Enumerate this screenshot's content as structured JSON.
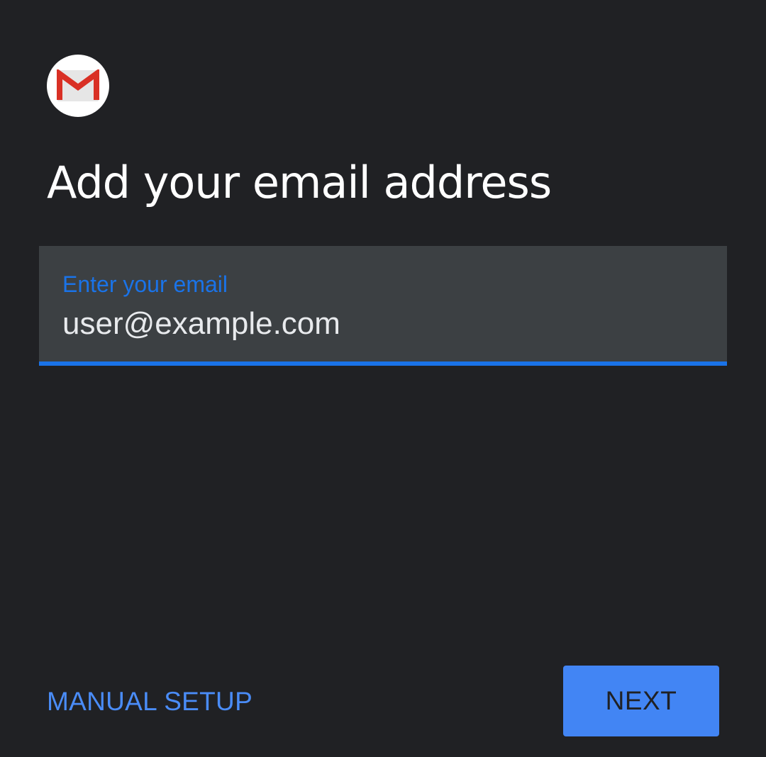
{
  "app": {
    "logo_icon": "gmail-icon",
    "accent_color": "#1a73e8",
    "background_color": "#202124"
  },
  "header": {
    "title": "Add your email address"
  },
  "email_field": {
    "label": "Enter your email",
    "value": "user@example.com"
  },
  "footer": {
    "manual_setup_label": "MANUAL SETUP",
    "next_label": "NEXT"
  }
}
